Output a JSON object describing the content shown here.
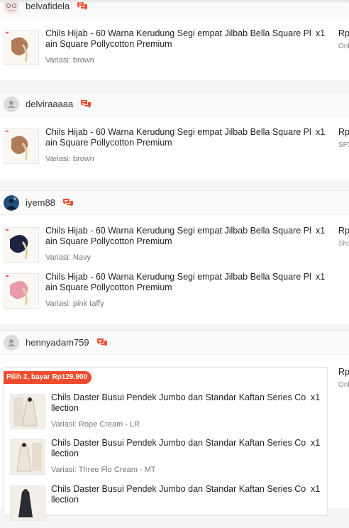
{
  "orders": [
    {
      "username": "belvafidela",
      "items": [
        {
          "name": "Chils Hijab - 60 Warna Kerudung Segi empat Jilbab Bella Square Pl ain Square Pollycotton Premium",
          "qty": "x1",
          "variant": "Variasi: brown",
          "price": "Rp",
          "status": "Onl",
          "color": "#b27b57"
        }
      ]
    },
    {
      "username": "delviraaaaa",
      "items": [
        {
          "name": "Chils Hijab - 60 Warna Kerudung Segi empat Jilbab Bella Square Pl ain Square Pollycotton Premium",
          "qty": "x1",
          "variant": "Variasi: brown",
          "price": "Rp",
          "status": "SPX",
          "color": "#b27b57"
        }
      ]
    },
    {
      "username": "iyem88",
      "items": [
        {
          "name": "Chils Hijab - 60 Warna Kerudung Segi empat Jilbab Bella Square Pl ain Square Pollycotton Premium",
          "qty": "x1",
          "variant": "Variasi: Navy",
          "price": "Rp",
          "status": "Sho",
          "color": "#1c2540"
        },
        {
          "name": "Chils Hijab - 60 Warna Kerudung Segi empat Jilbab Bella Square Pl ain Square Pollycotton Premium",
          "qty": "x1",
          "variant": "Variasi: pink taffy",
          "price": "",
          "status": "",
          "color": "#e89aa8"
        }
      ]
    },
    {
      "username": "hennyadam759",
      "price": "Rp",
      "status": "Onl",
      "bundle": {
        "tag": "Pilih 2, bayar Rp129.900",
        "items": [
          {
            "name": "Chils Daster Busui Pendek Jumbo dan Standar Kaftan Series Co llection",
            "qty": "x1",
            "variant": "Variasi: Rope Cream - LR"
          },
          {
            "name": "Chils Daster Busui Pendek Jumbo dan Standar Kaftan Series Co llection",
            "qty": "x1",
            "variant": "Variasi: Three Flo Cream - MT"
          },
          {
            "name": "Chils Daster Busui Pendek Jumbo dan Standar Kaftan Series Co llection",
            "qty": "x1",
            "variant": ""
          }
        ]
      }
    }
  ]
}
